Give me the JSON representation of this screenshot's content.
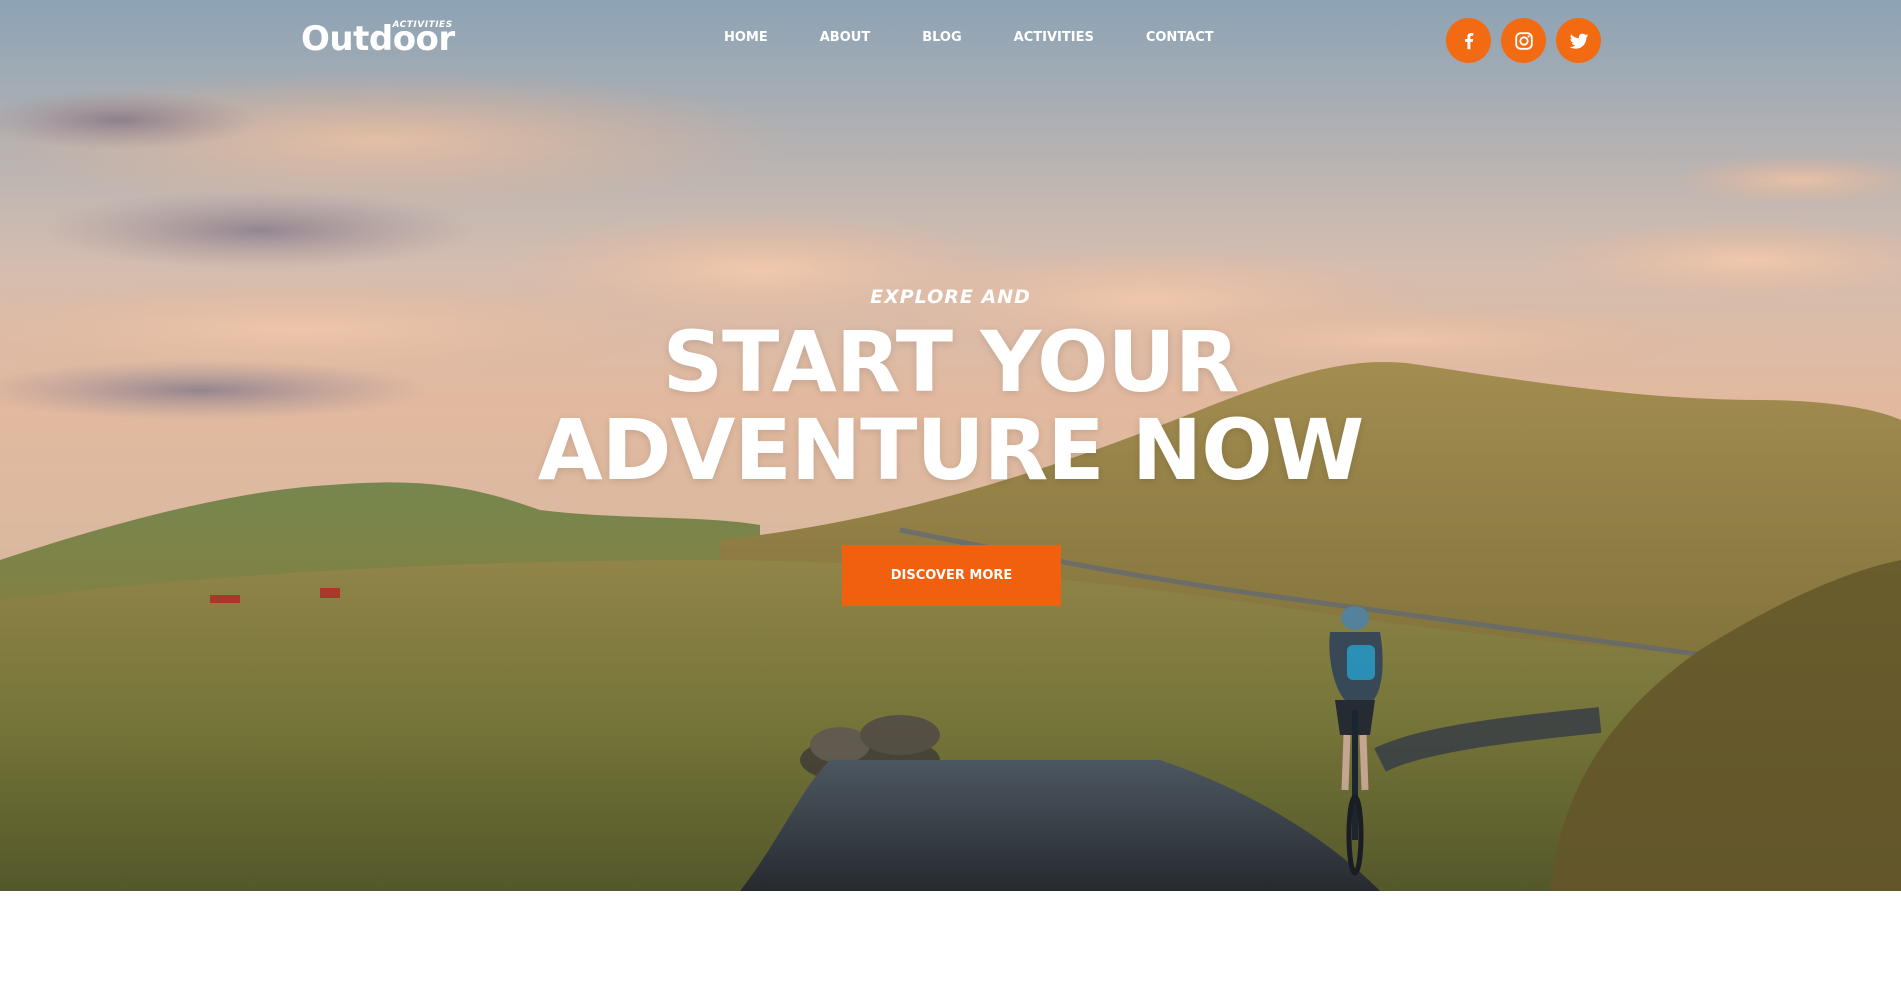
{
  "brand": {
    "name": "Outdoor",
    "tagline": "ACTIVITIES"
  },
  "nav": {
    "items": [
      "HOME",
      "ABOUT",
      "BLOG",
      "ACTIVITIES",
      "CONTACT"
    ]
  },
  "social": {
    "accent_color": "#f26a11",
    "icons": [
      "facebook-icon",
      "instagram-icon",
      "twitter-icon"
    ]
  },
  "hero": {
    "kicker": "EXPLORE AND",
    "headline_line1": "START YOUR",
    "headline_line2": "ADVENTURE NOW",
    "cta_label": "DISCOVER MORE",
    "cta_color": "#f0600f"
  }
}
